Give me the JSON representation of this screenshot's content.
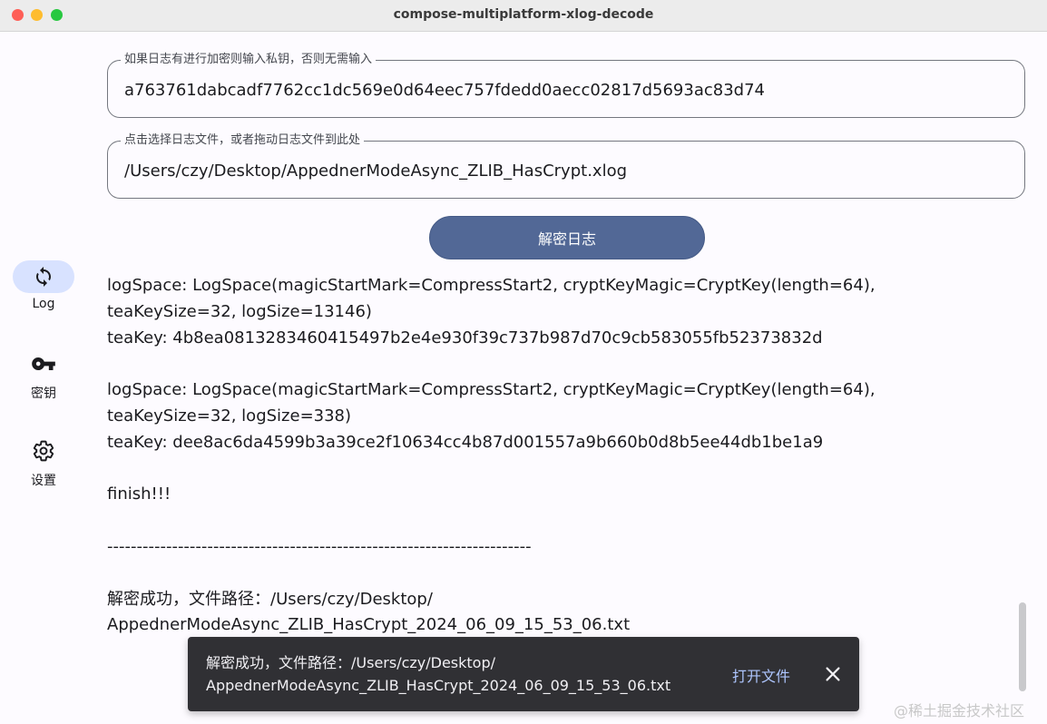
{
  "window": {
    "title": "compose-multiplatform-xlog-decode"
  },
  "sidebar": {
    "items": [
      {
        "label": "Log",
        "icon": "sync-icon",
        "active": true
      },
      {
        "label": "密钥",
        "icon": "key-icon",
        "active": false
      },
      {
        "label": "设置",
        "icon": "gear-icon",
        "active": false
      }
    ]
  },
  "private_key_field": {
    "label": "如果日志有进行加密则输入私钥，否则无需输入",
    "value": "a763761dabcadf7762cc1dc569e0d64eec757fdedd0aecc02817d5693ac83d74"
  },
  "file_field": {
    "label": "点击选择日志文件，或者拖动日志文件到此处",
    "value": "/Users/czy/Desktop/AppednerModeAsync_ZLIB_HasCrypt.xlog"
  },
  "decrypt_button": {
    "label": "解密日志"
  },
  "log_output": "logSpace: LogSpace(magicStartMark=CompressStart2, cryptKeyMagic=CryptKey(length=64),\nteaKeySize=32, logSize=13146)\nteaKey: 4b8ea0813283460415497b2e4e930f39c737b987d70c9cb583055fb52373832d\n\nlogSpace: LogSpace(magicStartMark=CompressStart2, cryptKeyMagic=CryptKey(length=64),\nteaKeySize=32, logSize=338)\nteaKey: dee8ac6da4599b3a39ce2f10634cc4b87d001557a9b660b0d8b5ee44db1be1a9\n\nfinish!!!\n\n------------------------------------------------------------------------\n\n解密成功，文件路径：/Users/czy/Desktop/\nAppednerModeAsync_ZLIB_HasCrypt_2024_06_09_15_53_06.txt",
  "snackbar": {
    "message": "解密成功，文件路径：/Users/czy/Desktop/\nAppednerModeAsync_ZLIB_HasCrypt_2024_06_09_15_53_06.txt",
    "action": "打开文件"
  },
  "watermark": "@稀土掘金技术社区",
  "colors": {
    "accent": "#526896",
    "nav_active_bg": "#d8e2ff",
    "snackbar_bg": "#303034",
    "snackbar_action": "#aec6ff"
  }
}
